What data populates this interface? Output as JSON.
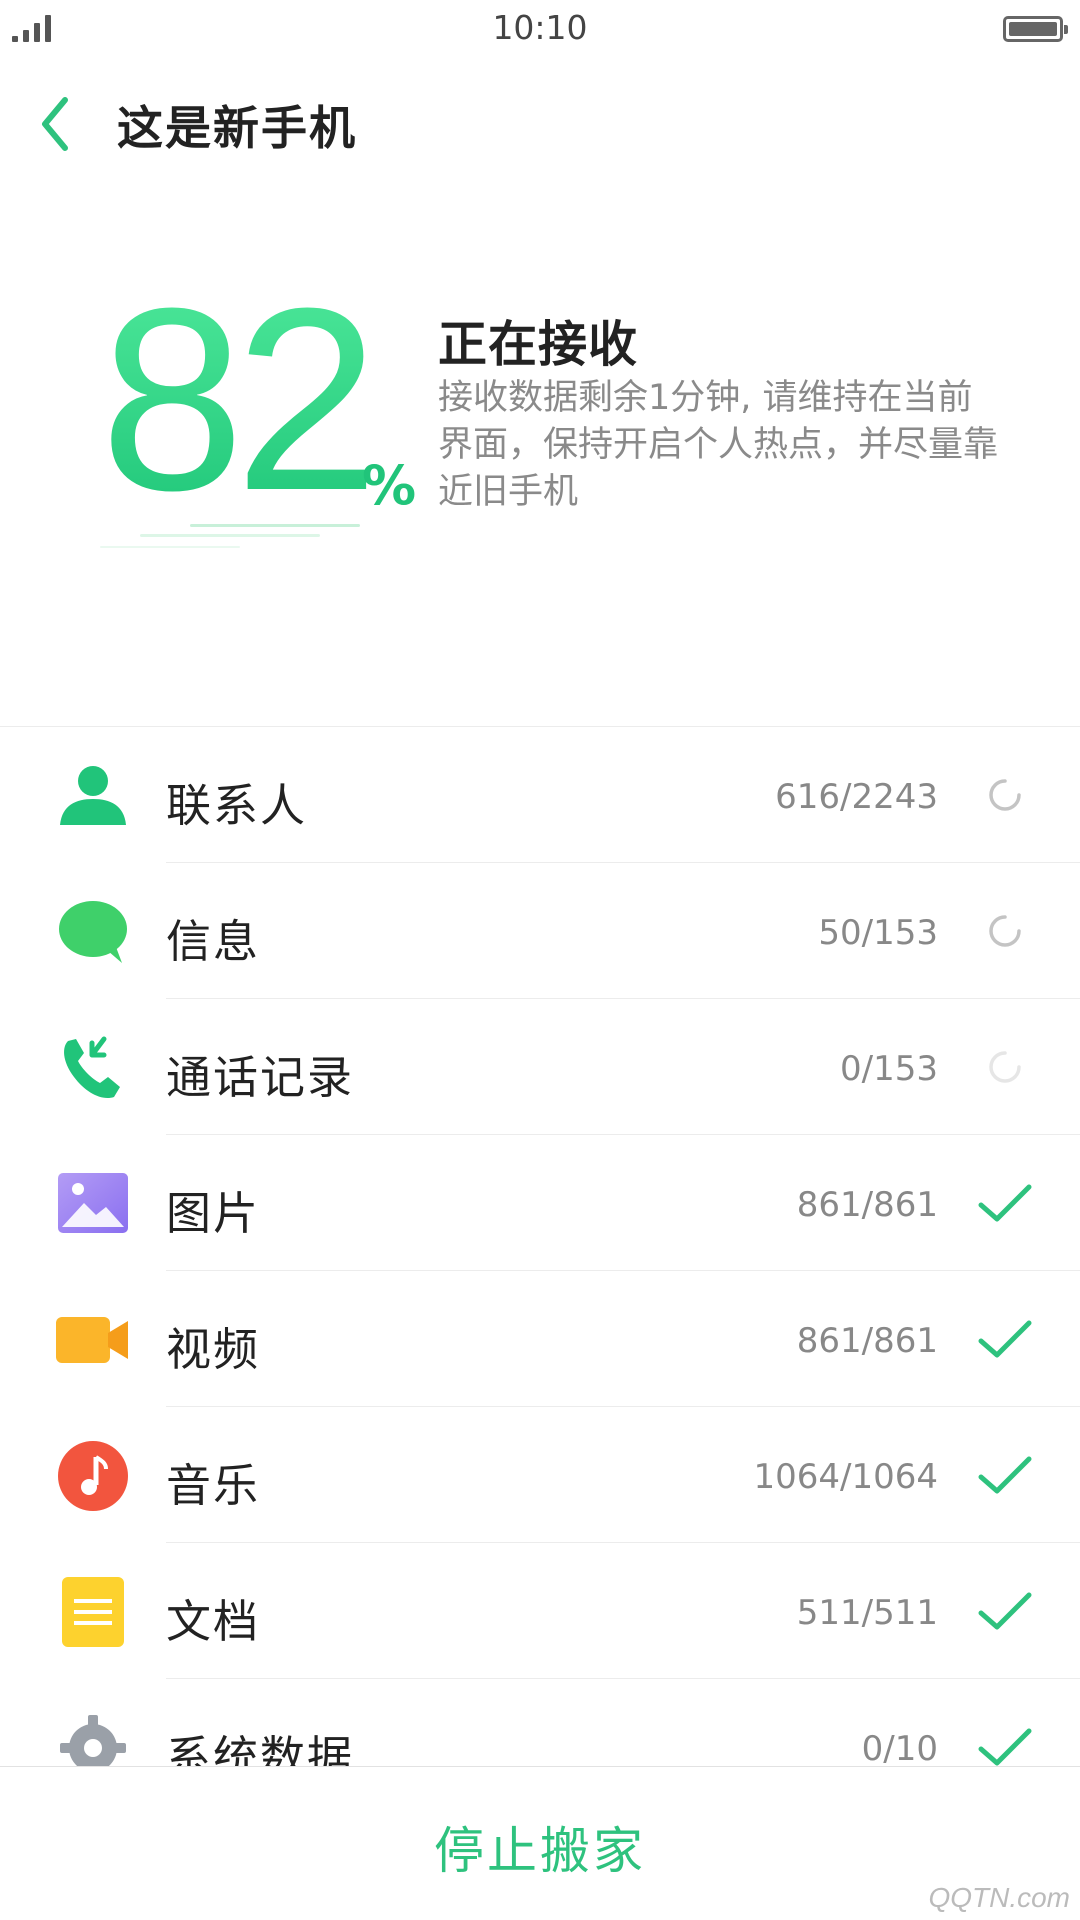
{
  "status_bar": {
    "time": "10:10"
  },
  "header": {
    "title": "这是新手机"
  },
  "progress": {
    "percent": "82",
    "percent_sign": "%",
    "status_title": "正在接收",
    "description": "接收数据剩余1分钟, 请维持在当前界面，保持开启个人热点，并尽量靠近旧手机"
  },
  "items": [
    {
      "label": "联系人",
      "count": "616/2243",
      "state": "loading",
      "icon": "contacts-icon"
    },
    {
      "label": "信息",
      "count": "50/153",
      "state": "loading",
      "icon": "messages-icon"
    },
    {
      "label": "通话记录",
      "count": "0/153",
      "state": "waiting",
      "icon": "call-log-icon"
    },
    {
      "label": "图片",
      "count": "861/861",
      "state": "done",
      "icon": "photos-icon"
    },
    {
      "label": "视频",
      "count": "861/861",
      "state": "done",
      "icon": "video-icon"
    },
    {
      "label": "音乐",
      "count": "1064/1064",
      "state": "done",
      "icon": "music-icon"
    },
    {
      "label": "文档",
      "count": "511/511",
      "state": "done",
      "icon": "documents-icon"
    },
    {
      "label": "系统数据",
      "count": "0/10",
      "state": "done",
      "icon": "gear-icon"
    }
  ],
  "bottom": {
    "stop_label": "停止搬家"
  },
  "watermark": "QQTN.com",
  "colors": {
    "accent": "#2ec27e",
    "text": "#222222",
    "muted": "#888888"
  }
}
